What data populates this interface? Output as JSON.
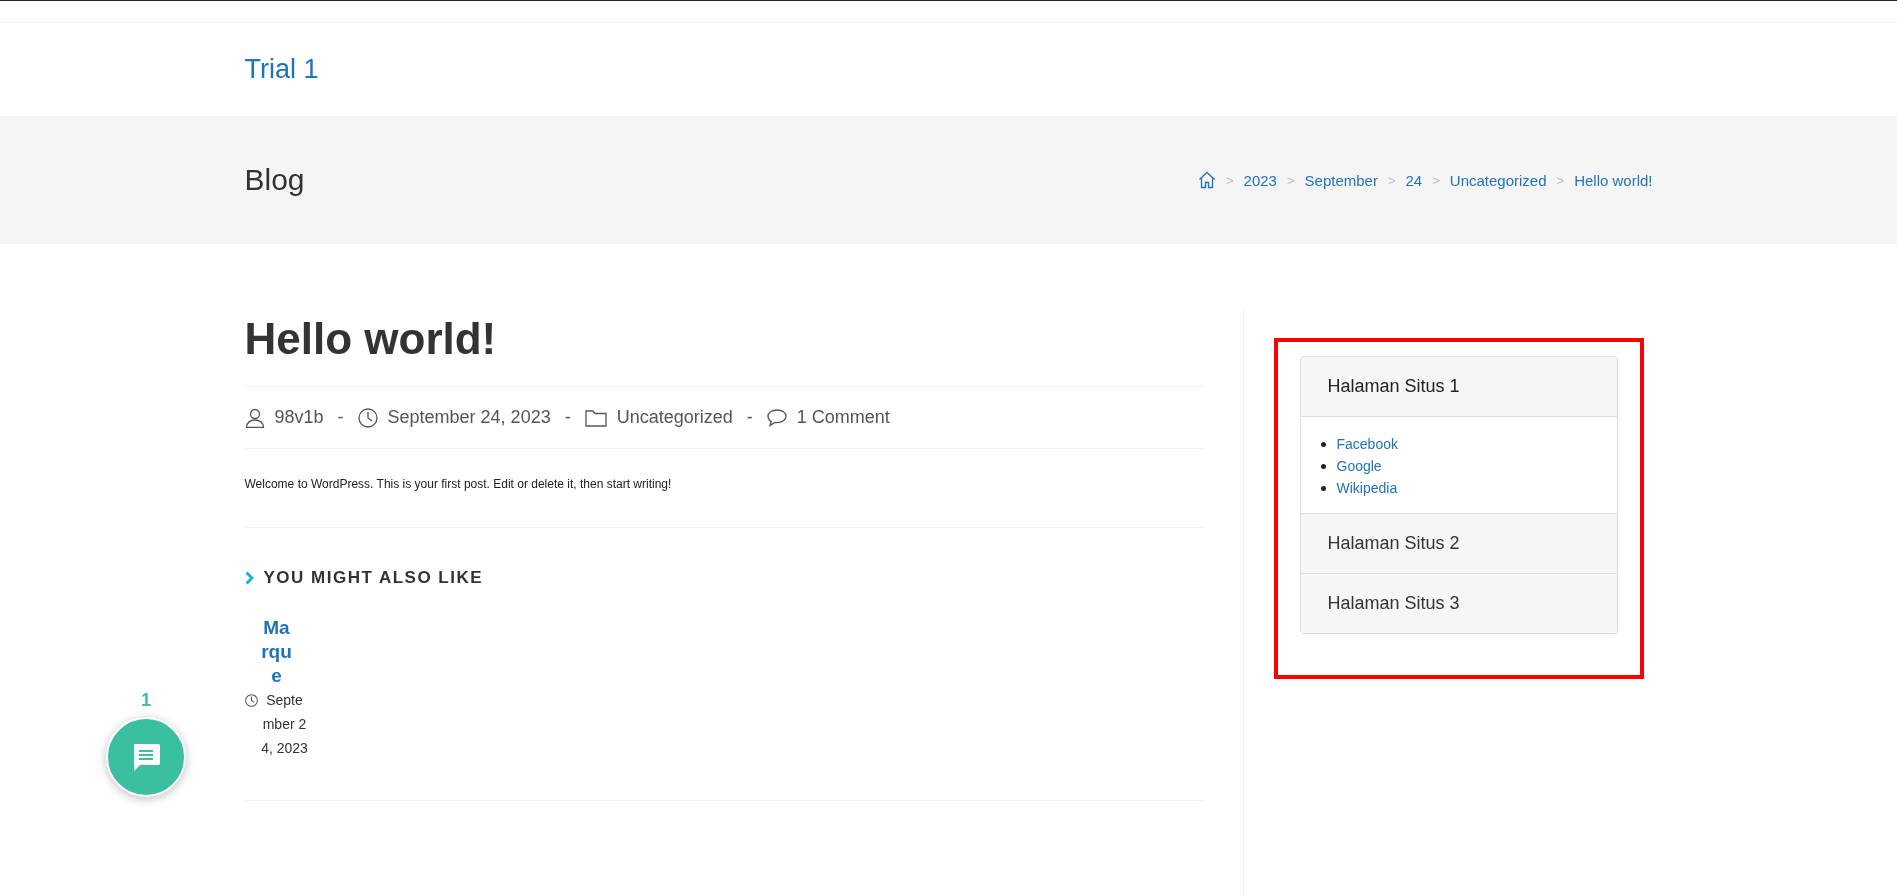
{
  "site_title": "Trial 1",
  "page_header": {
    "title": "Blog",
    "separator": ">",
    "breadcrumb": [
      "2023",
      "September",
      "24",
      "Uncategorized",
      "Hello world!"
    ]
  },
  "post": {
    "title": "Hello world!",
    "meta_separator": "-",
    "meta": [
      {
        "kind": "author",
        "text": "98v1b"
      },
      {
        "kind": "date",
        "text": "September 24, 2023"
      },
      {
        "kind": "category",
        "text": "Uncategorized"
      },
      {
        "kind": "comments",
        "text": "1 Comment"
      }
    ],
    "content": "Welcome to WordPress. This is your first post. Edit or delete it, then start writing!",
    "related": {
      "heading": "YOU MIGHT ALSO LIKE",
      "items": [
        {
          "title": "Marque",
          "date": "September 24, 2023"
        }
      ]
    }
  },
  "sidebar": {
    "highlighted": true,
    "accordion": [
      {
        "title": "Halaman Situs 1",
        "expanded": true,
        "links": [
          "Facebook",
          "Google",
          "Wikipedia"
        ]
      },
      {
        "title": "Halaman Situs 2",
        "expanded": false
      },
      {
        "title": "Halaman Situs 3",
        "expanded": false
      }
    ]
  },
  "chat": {
    "count": "1"
  }
}
